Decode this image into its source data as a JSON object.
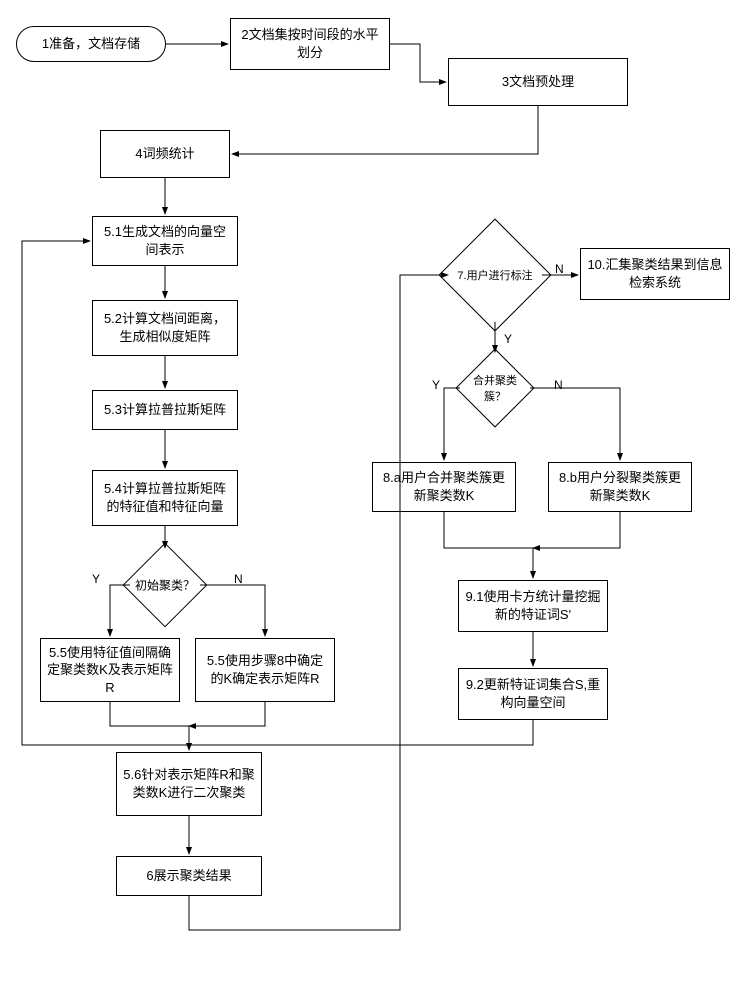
{
  "nodes": {
    "n1": "1准备，文档存储",
    "n2": "2文档集按时间段的水平划分",
    "n3": "3文档预处理",
    "n4": "4词频统计",
    "n5_1": "5.1生成文档的向量空间表示",
    "n5_2": "5.2计算文档间距离，生成相似度矩阵",
    "n5_3": "5.3计算拉普拉斯矩阵",
    "n5_4": "5.4计算拉普拉斯矩阵的特征值和特征向量",
    "d_init": "初始聚类？",
    "n5_5a": "5.5使用特征值间隔确定聚类数K及表示矩阵R",
    "n5_5b": "5.5使用步骤8中确定的K确定表示矩阵R",
    "n5_6": "5.6针对表示矩阵R和聚类数K进行二次聚类",
    "n6": "6展示聚类结果",
    "d7": "7.用户进行标注",
    "d_merge": "合并聚类簇？",
    "n8a": "8.a用户合并聚类簇更新聚类数K",
    "n8b": "8.b用户分裂聚类簇更新聚类数K",
    "n9_1": "9.1使用卡方统计量挖掘新的特证词S'",
    "n9_2": "9.2更新特证词集合S,重构向量空间",
    "n10": "10.汇集聚类结果到信息检索系统"
  },
  "labels": {
    "Y": "Y",
    "N": "N"
  }
}
